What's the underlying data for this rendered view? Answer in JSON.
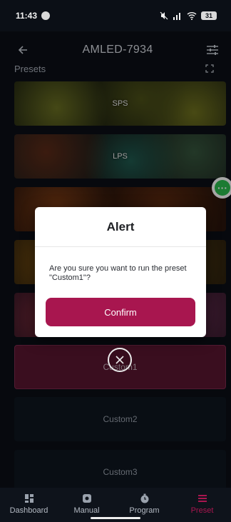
{
  "status_bar": {
    "time": "11:43",
    "battery": "31"
  },
  "header": {
    "title": "AMLED-7934",
    "subtitle": "Presets"
  },
  "presets": [
    {
      "label": "SPS"
    },
    {
      "label": "LPS"
    },
    {
      "label": ""
    },
    {
      "label": ""
    },
    {
      "label": ""
    },
    {
      "label": "Custom1"
    },
    {
      "label": "Custom2"
    },
    {
      "label": "Custom3"
    }
  ],
  "alert": {
    "title": "Alert",
    "message": "Are you sure you want to run the preset \"Custom1\"?",
    "confirm_label": "Confirm"
  },
  "bottom_nav": {
    "items": [
      {
        "label": "Dashboard",
        "icon": "dashboard-icon"
      },
      {
        "label": "Manual",
        "icon": "manual-icon"
      },
      {
        "label": "Program",
        "icon": "program-icon"
      },
      {
        "label": "Preset",
        "icon": "preset-icon"
      }
    ],
    "active": "Preset"
  },
  "colors": {
    "accent": "#a8164f",
    "background": "#0b0f16",
    "chat_green": "#2bbd4f"
  }
}
